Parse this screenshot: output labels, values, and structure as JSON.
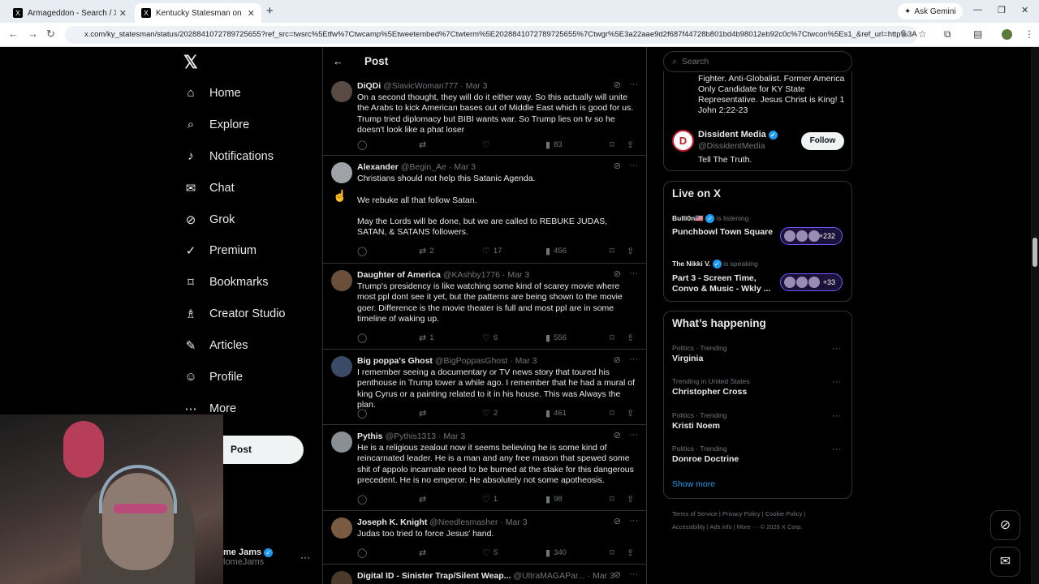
{
  "browser": {
    "tabs": [
      {
        "label": "Armageddon - Search / X",
        "favicon": "X"
      },
      {
        "label": "Kentucky Statesman on X: \"Dor",
        "favicon": "X"
      }
    ],
    "new_tab": "+",
    "gemini": "Ask Gemini",
    "url": "x.com/ky_statesman/status/2028841072789725655?ref_src=twsrc%5Etfw%7Ctwcamp%5Etweetembed%7Ctwterm%5E2028841072789725655%7Ctwgr%5E3a22aae9d2f687f44728b801bd4b98012eb92c0c%7Ctwcon%5Es1_&ref_url=http%3A%..."
  },
  "nav": {
    "items": [
      {
        "label": "Home",
        "icon": "home-icon",
        "glyph": "⌂"
      },
      {
        "label": "Explore",
        "icon": "search-icon",
        "glyph": "⌕"
      },
      {
        "label": "Notifications",
        "icon": "bell-icon",
        "glyph": "🔔"
      },
      {
        "label": "Chat",
        "icon": "mail-icon",
        "glyph": "✉"
      },
      {
        "label": "Grok",
        "icon": "grok-icon",
        "glyph": "⊘"
      },
      {
        "label": "Premium",
        "icon": "premium-icon",
        "glyph": "✓"
      },
      {
        "label": "Bookmarks",
        "icon": "bookmark-icon",
        "glyph": "⌑"
      },
      {
        "label": "Creator Studio",
        "icon": "creator-icon",
        "glyph": "♗"
      },
      {
        "label": "Articles",
        "icon": "article-icon",
        "glyph": "✎"
      },
      {
        "label": "Profile",
        "icon": "person-icon",
        "glyph": "☺"
      },
      {
        "label": "More",
        "icon": "more-icon",
        "glyph": "⋯"
      }
    ],
    "post_button": "Post",
    "account": {
      "name": "me Jams",
      "handle": "lomeJams"
    }
  },
  "main": {
    "title": "Post",
    "tweets": [
      {
        "name": "DiQDi",
        "handle": "@SlavicWoman777 · Mar 3",
        "text": "On a second thought, they will do it either way. So this actually will unite the Arabs to kick American bases out of Middle East which is good for us. Trump tried diplomacy but BIBI wants war. So Trump lies on tv so he doesn't look like a  phat loser",
        "replies": "",
        "reposts": "",
        "likes": "",
        "views": "83",
        "avatar_color": "#5a4a44"
      },
      {
        "name": "Alexander",
        "handle": "@Begin_Ae · Mar 3",
        "text": "Christians should not help this Satanic Agenda.\n\nWe rebuke all that follow Satan.\n\nMay the Lords will be done, but we are called to REBUKE JUDAS, SATAN, & SATANS followers.",
        "replies": "",
        "reposts": "2",
        "likes": "17",
        "views": "456",
        "avatar_color": "#9fa3a8"
      },
      {
        "name": "Daughter of America",
        "handle": "@KAshby1776 · Mar 3",
        "text": "Trump's presidency is like watching some kind of scarey movie where most ppl dont see it yet, but the patterns are being shown to the movie goer. Difference is the movie theater is full and most ppl are in some timeline of waking up.",
        "replies": "",
        "reposts": "1",
        "likes": "6",
        "views": "556",
        "avatar_color": "#6b4f3a"
      },
      {
        "name": "Big poppa's Ghost",
        "handle": "@BigPoppasGhost · Mar 3",
        "text": "I remember seeing a documentary or TV news story that toured his penthouse in Trump tower a while ago. I remember that he had a mural of king Cyrus or a painting related to it in his house. This was Always the plan.",
        "replies": "",
        "reposts": "",
        "likes": "2",
        "views": "461",
        "avatar_color": "#3b4a66"
      },
      {
        "name": "Pythis",
        "handle": "@Pythis1313 · Mar 3",
        "text": "He is a religious zealout now it seems believing he is some kind of reincarnated leader.  He is a man and any free mason that spewed some shit of appolo incarnate need to be burned at the stake for this dangerous precedent. He is no emperor. He absolutely not some apotheosis.",
        "replies": "",
        "reposts": "",
        "likes": "1",
        "views": "98",
        "avatar_color": "#8a8f96"
      },
      {
        "name": "Joseph K. Knight",
        "handle": "@Needlesmasher · Mar 3",
        "text": "Judas too tried to force Jesus' hand.",
        "replies": "",
        "reposts": "",
        "likes": "5",
        "views": "340",
        "avatar_color": "#7a5a40"
      },
      {
        "name": "Digital ID - Sinister Trap/Silent Weap...",
        "handle": "@UltraMAGAPar... · Mar 3",
        "text": "",
        "replies": "",
        "reposts": "",
        "likes": "",
        "views": "",
        "avatar_color": "#4a3a2a"
      }
    ]
  },
  "right": {
    "search_placeholder": "Search",
    "bio": "Fighter. Anti-Globalist. Former America Only Candidate for KY State Representative. Jesus Christ is King! 1 John 2:22-23",
    "suggest": {
      "name": "Dissident Media",
      "handle": "@DissidentMedia",
      "bio": "Tell The Truth.",
      "follow": "Follow",
      "avatar_letter": "D"
    },
    "live_title": "Live on X",
    "spaces": [
      {
        "host": "Bulli0n🇺🇸",
        "status": "is listening",
        "title": "Punchbowl Town Square",
        "count": "+232"
      },
      {
        "host": "The Nikki V.",
        "status": "is speaking",
        "title": "Part 3 - Screen Time, Convo & Music - Wkly ...",
        "count": "+33"
      }
    ],
    "happening_title": "What’s happening",
    "trends": [
      {
        "meta": "Politics · Trending",
        "name": "Virginia"
      },
      {
        "meta": "Trending in United States",
        "name": "Christopher Cross"
      },
      {
        "meta": "Politics · Trending",
        "name": "Kristi Noem"
      },
      {
        "meta": "Politics · Trending",
        "name": "Donroe Doctrine"
      }
    ],
    "show_more": "Show more",
    "footer_line1": "Terms of Service  |  Privacy Policy  |  Cookie Policy  |",
    "footer_line2": "Accessibility  |  Ads info  |  More ···  © 2026 X Corp."
  }
}
